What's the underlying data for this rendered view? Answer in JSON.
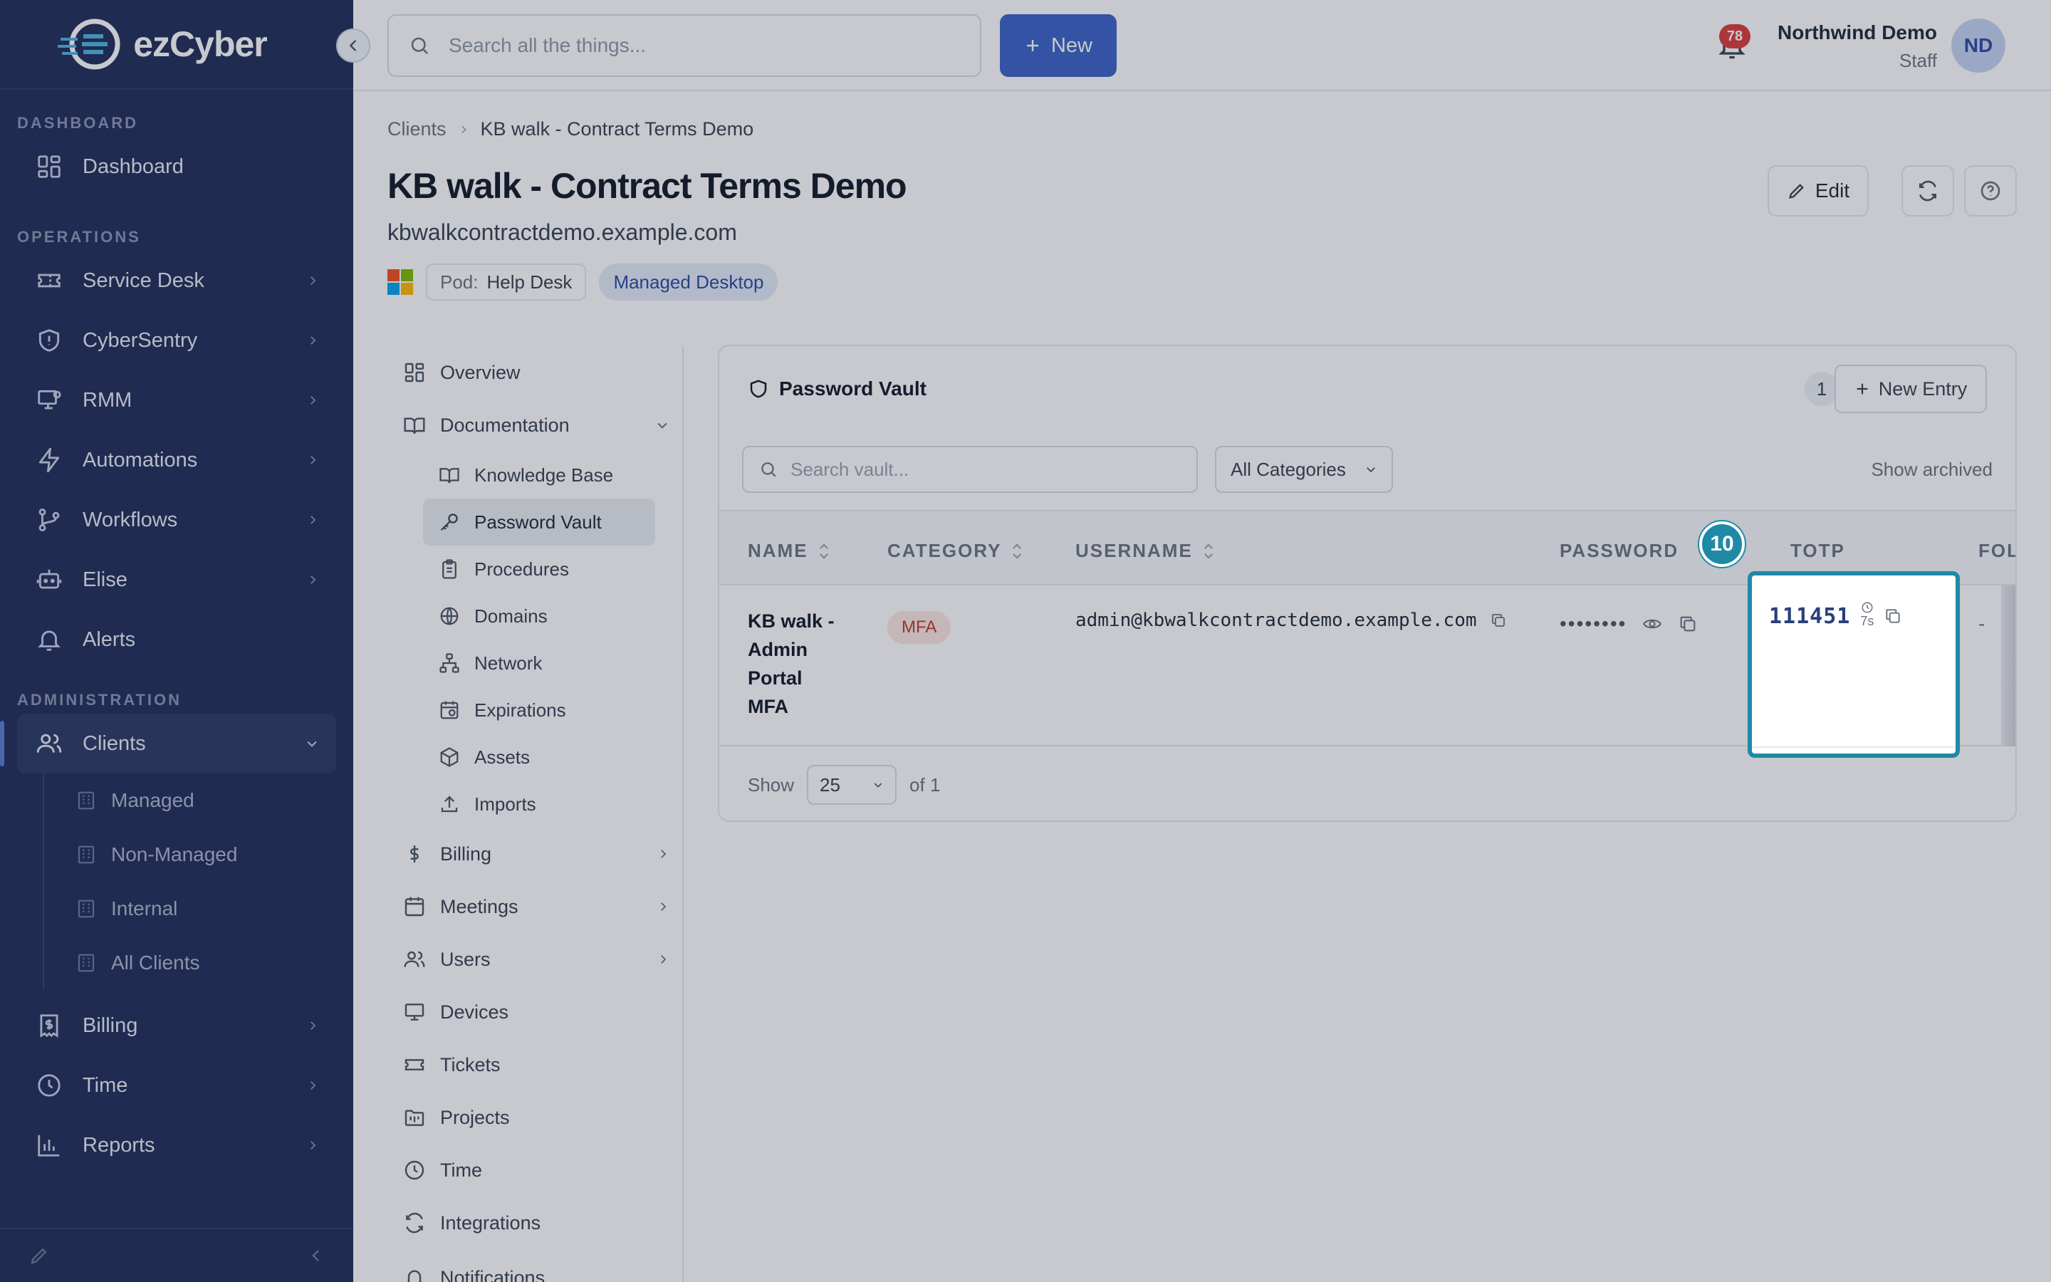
{
  "brand": {
    "name": "ezCyber"
  },
  "sidebar": {
    "sections": {
      "dashboard": "DASHBOARD",
      "operations": "OPERATIONS",
      "administration": "ADMINISTRATION"
    },
    "items": {
      "dashboard": "Dashboard",
      "service_desk": "Service Desk",
      "cybersentry": "CyberSentry",
      "rmm": "RMM",
      "automations": "Automations",
      "workflows": "Workflows",
      "elise": "Elise",
      "alerts": "Alerts",
      "clients": "Clients",
      "billing": "Billing",
      "time": "Time",
      "reports": "Reports"
    },
    "clients_children": [
      "Managed",
      "Non-Managed",
      "Internal",
      "All Clients"
    ]
  },
  "topbar": {
    "search_placeholder": "Search all the things...",
    "new_label": "New",
    "notification_count": "78",
    "user_name": "Northwind Demo",
    "user_role": "Staff",
    "avatar_initials": "ND"
  },
  "page": {
    "breadcrumb": [
      "Clients",
      "KB walk - Contract Terms Demo"
    ],
    "title": "KB walk - Contract Terms Demo",
    "domain": "kbwalkcontractdemo.example.com",
    "pod_key": "Pod:",
    "pod_value": "Help Desk",
    "tag": "Managed Desktop",
    "edit_label": "Edit"
  },
  "subnav": {
    "overview": "Overview",
    "documentation": "Documentation",
    "doc_children": [
      "Knowledge Base",
      "Password Vault",
      "Procedures",
      "Domains",
      "Network",
      "Expirations",
      "Assets",
      "Imports"
    ],
    "billing": "Billing",
    "meetings": "Meetings",
    "users": "Users",
    "devices": "Devices",
    "tickets": "Tickets",
    "projects": "Projects",
    "time": "Time",
    "integrations": "Integrations",
    "notifications": "Notifications"
  },
  "vault": {
    "title": "Password Vault",
    "count": "1",
    "new_entry_label": "New Entry",
    "search_placeholder": "Search vault...",
    "category_filter": "All Categories",
    "show_archived": "Show archived",
    "columns": [
      "NAME",
      "CATEGORY",
      "USERNAME",
      "PASSWORD",
      "TOTP",
      "FOL"
    ],
    "rows": [
      {
        "name": "KB walk - Admin Portal MFA",
        "category": "MFA",
        "username": "admin@kbwalkcontractdemo.example.com",
        "password_mask": "••••••••",
        "totp": "111451",
        "totp_timer": "7s",
        "folder": "-"
      }
    ],
    "footer_show": "Show",
    "per_page": "25",
    "of_pages": "of 1"
  },
  "overlay": {
    "step_number": "10"
  },
  "colors": {
    "sidebar_bg": "#1f2d57",
    "accent": "#3b62c7",
    "highlight": "#1f8aa6",
    "badge_red": "#dc3b3b"
  }
}
